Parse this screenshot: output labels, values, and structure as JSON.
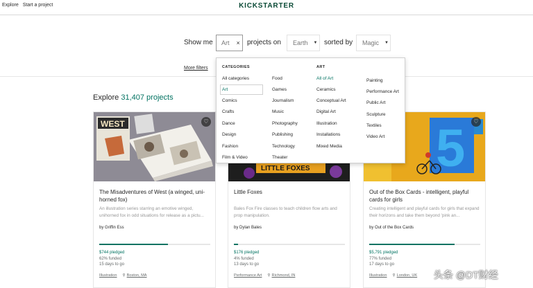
{
  "topbar": {
    "nav": [
      "Explore",
      "Start a project"
    ],
    "logo": "KICKSTARTER"
  },
  "filter": {
    "show_me": "Show me",
    "category_value": "Art",
    "projects_on": "projects on",
    "location_value": "Earth",
    "sorted_by": "sorted by",
    "sort_value": "Magic",
    "more_filters": "More filters"
  },
  "explore": {
    "prefix": "Explore",
    "count": "31,407 projects"
  },
  "dropdown": {
    "categories_heading": "CATEGORIES",
    "art_heading": "ART",
    "col1": [
      "All categories",
      "Art",
      "Comics",
      "Crafts",
      "Dance",
      "Design",
      "Fashion",
      "Film & Video"
    ],
    "col2": [
      "Food",
      "Games",
      "Journalism",
      "Music",
      "Photography",
      "Publishing",
      "Technology",
      "Theater"
    ],
    "col3": [
      "All of Art",
      "Ceramics",
      "Conceptual Art",
      "Digital Art",
      "Illustration",
      "Installations",
      "Mixed Media"
    ],
    "col4": [
      "Painting",
      "Performance Art",
      "Public Art",
      "Sculpture",
      "Textiles",
      "Video Art"
    ]
  },
  "cards": [
    {
      "title": "The Misadventures of West (a winged, uni-horned fox)",
      "blurb": "An illustration series starring an emotive winged, unihorned fox in odd situations for release as a pictu...",
      "by": "by Griffin Ess",
      "pledged": "$744 pledged",
      "funded": "62% funded",
      "funded_pct": 62,
      "days": "15 days to go",
      "category": "Illustration",
      "location": "Boston, MA",
      "image_text": "WEST"
    },
    {
      "title": "Little Foxes",
      "blurb": "Bales Fox Fire classes to teach children flow arts and prop manipulation.",
      "by": "by Dylan Bales",
      "pledged": "$176 pledged",
      "funded": "4% funded",
      "funded_pct": 4,
      "days": "13 days to go",
      "category": "Performance Art",
      "location": "Richmond, IN",
      "image_text": "LITTLE FOXES"
    },
    {
      "title": "Out of the Box Cards - intelligent, playful cards for girls",
      "blurb": "Creating intelligent and playful cards for girls that expand their horizons and take them beyond 'pink an...",
      "by": "by Out of the Box Cards",
      "pledged": "$5,791 pledged",
      "funded": "77% funded",
      "funded_pct": 77,
      "days": "17 days to go",
      "category": "Illustration",
      "location": "London, UK",
      "image_text": "5"
    }
  ],
  "watermark": "头条 @DT财经",
  "colors": {
    "accent": "#037362",
    "logo": "#0a4a36"
  }
}
